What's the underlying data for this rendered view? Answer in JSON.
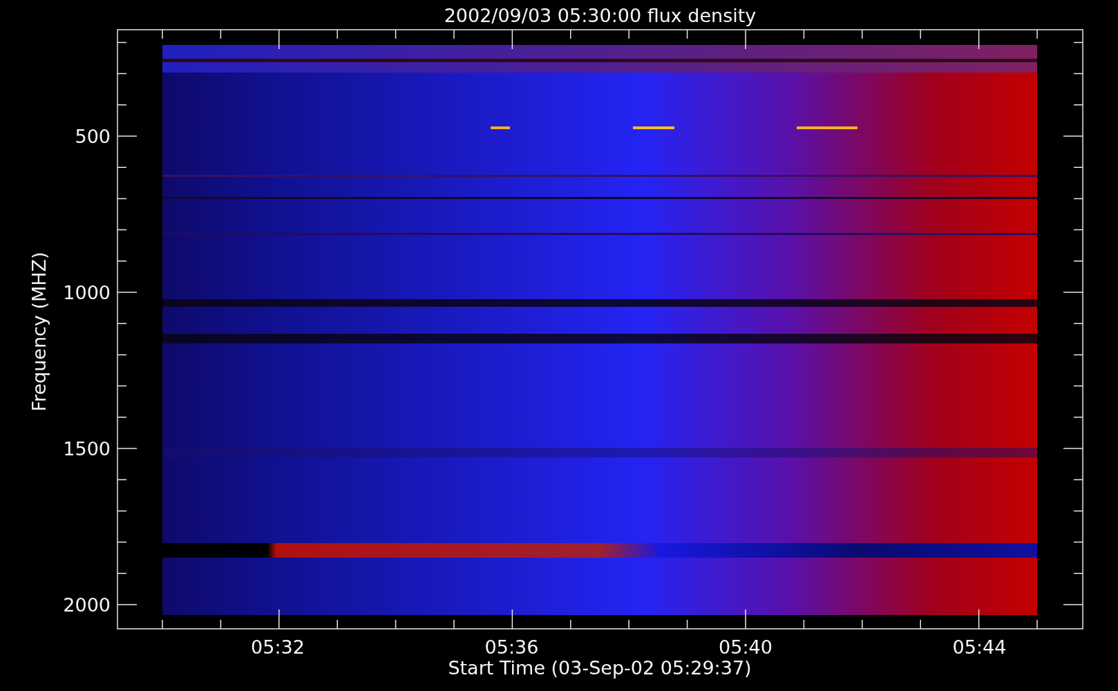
{
  "title": "2002/09/03 05:30:00 flux density",
  "y_axis": {
    "label": "Frequency (MHZ)",
    "ticks": [
      "500",
      "1000",
      "1500",
      "2000"
    ]
  },
  "x_axis": {
    "label": "Start Time (03-Sep-02 05:29:37)",
    "ticks": [
      "05:32",
      "05:36",
      "05:40",
      "05:44"
    ]
  }
}
